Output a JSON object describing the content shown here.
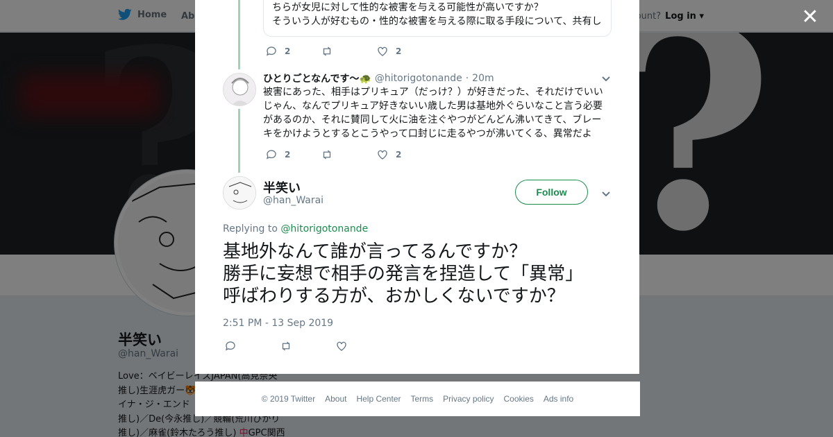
{
  "nav": {
    "home_label": "Home",
    "about_label": "Abo",
    "account_prompt": "ccount?",
    "login_label": "Log in"
  },
  "profile": {
    "name": "半笑い",
    "handle": "@han_Warai",
    "bio_lines": [
      "Love：ベイビーレイズJAPAN(高見奈央",
      "推し)生涯虎ガー🐯",
      "イナ・ジ・エンド",
      "推し)／De(今永推し)／競輪(荒川ひかり",
      "推し)／麻雀(鈴木たろう推し)"
    ],
    "bio_flag": "中",
    "bio_tail": "GPC関西"
  },
  "quoted_tweet": {
    "lines": [
      "ちらが女児に対して性的な被害を与える可能性が高いですか？",
      "そういう人が好むもの・性的な被害を与える際に取る手段について、共有し"
    ],
    "reply_count": "2",
    "like_count": "2"
  },
  "reply_tweet": {
    "name": "ひとりごとなんです～",
    "name_emoji": "🐢",
    "handle": "@hitorigotonande",
    "separator": "·",
    "time": "20m",
    "body_lines": [
      "被害にあった、相手はプリキュア（だっけ？）が好きだった、それだけでいい",
      "じゃん、なんでプリキュア好きないい歳した男は基地外ぐらいなこと言う必要",
      "があるのか、それに賛同して火に油を注ぐやつがどんどん沸いてきて、ブレー",
      "キをかけようとするとこうやって口封じに走るやつが沸いてくる、異常だよ"
    ],
    "reply_count": "2",
    "like_count": "2"
  },
  "main_tweet": {
    "name": "半笑い",
    "handle": "@han_Warai",
    "follow_label": "Follow",
    "replying_prefix": "Replying to",
    "replying_to": "@hitorigotonande",
    "text_lines": [
      "基地外なんて誰が言ってるんですか？",
      "勝手に妄想で相手の発言を捏造して「異常」",
      "呼ばわりする方が、おかしくないですか？"
    ],
    "timestamp": "2:51 PM - 13 Sep 2019"
  },
  "footer": {
    "links": [
      "© 2019 Twitter",
      "About",
      "Help Center",
      "Terms",
      "Privacy policy",
      "Cookies",
      "Ads info"
    ]
  },
  "colors": {
    "accent_green": "#1b8c4e",
    "thread_line": "#9ed6b4",
    "twitter_blue": "#1da1f2",
    "muted": "#657786"
  },
  "icons": [
    "twitter-bird-icon",
    "close-icon",
    "reply-icon",
    "retweet-icon",
    "like-icon",
    "chevron-down-icon"
  ]
}
